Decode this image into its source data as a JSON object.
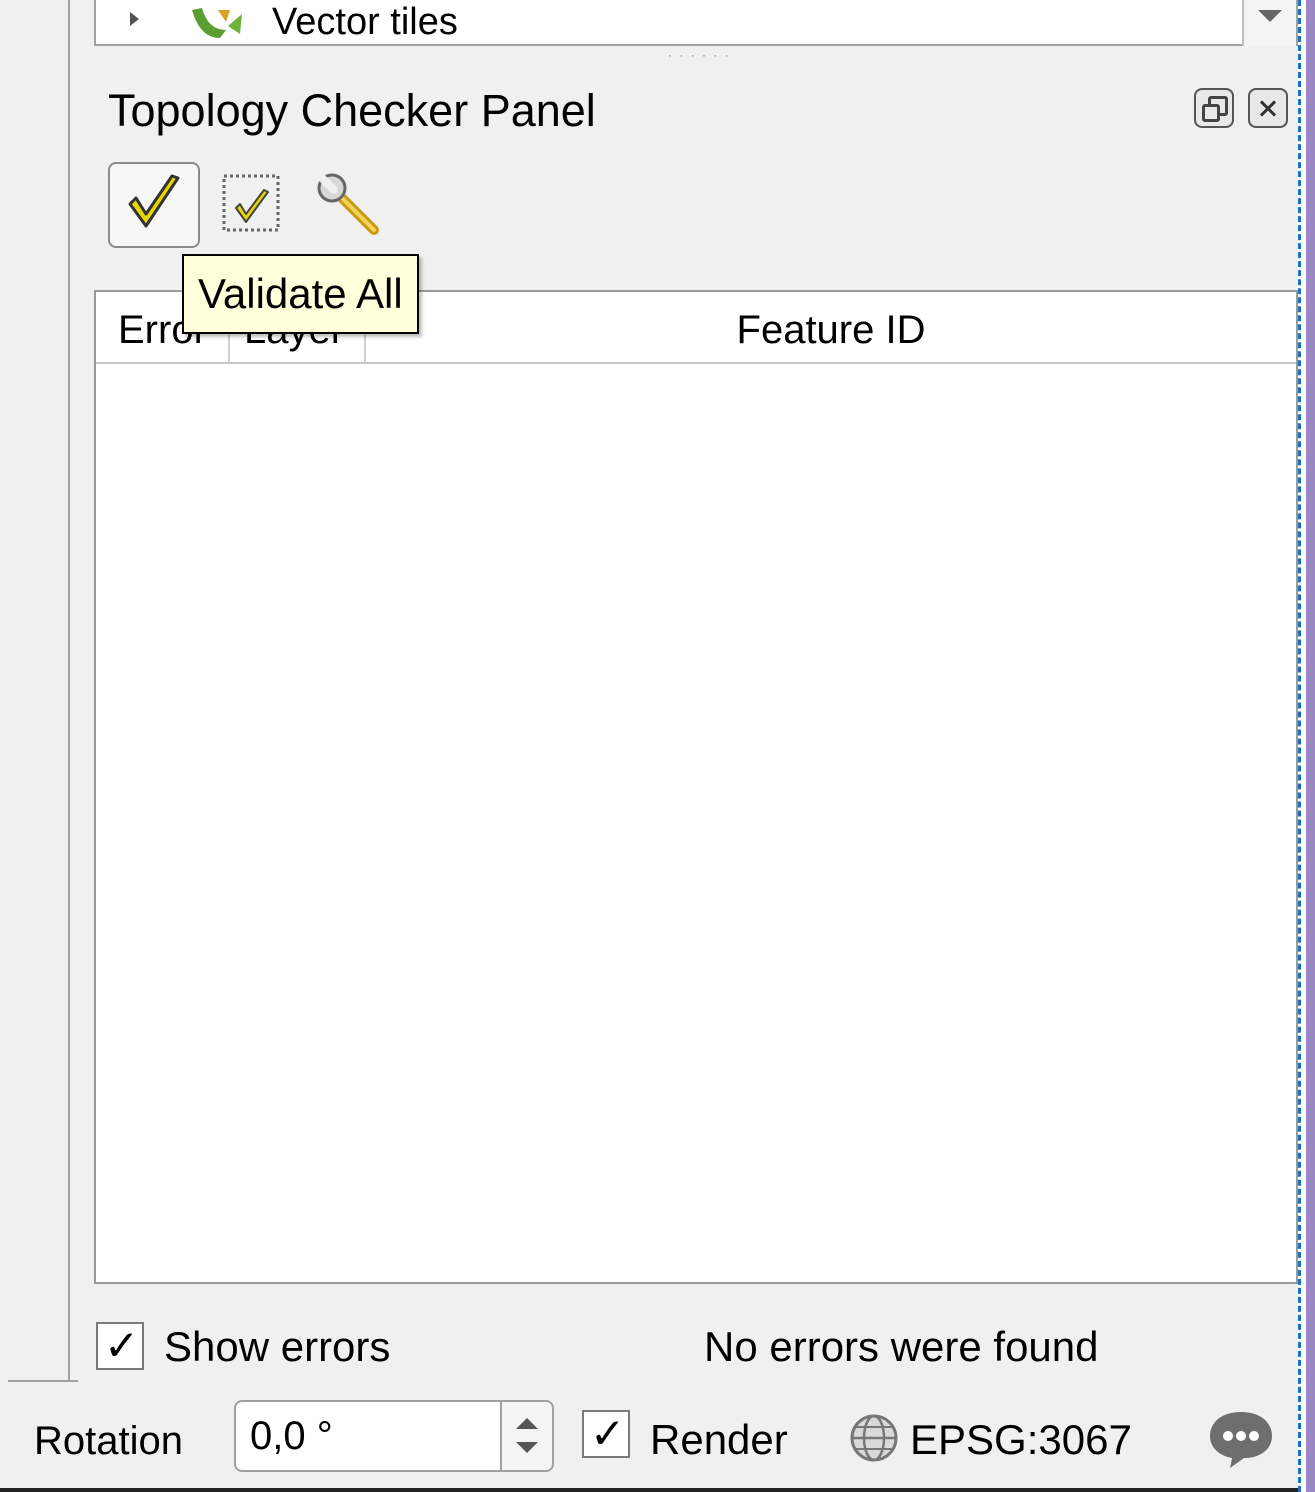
{
  "layer_tree": {
    "partial_item_label": "Vector tiles"
  },
  "panel": {
    "title": "Topology Checker Panel",
    "tooltip": "Validate All"
  },
  "table": {
    "columns": [
      "Error",
      "Layer",
      "Feature ID"
    ]
  },
  "footer": {
    "show_errors_label": "Show errors",
    "show_errors_checked": true,
    "checkbox_mark": "✓",
    "status_text": "No errors were found"
  },
  "statusbar": {
    "rotation_label": "Rotation",
    "rotation_value": "0,0 °",
    "render_label": "Render",
    "render_checked": true,
    "crs_label": "EPSG:3067"
  },
  "icons": {
    "validate_all": "checkmark-icon",
    "validate_extent": "checkmark-extent-icon",
    "configure": "wrench-icon",
    "crs": "globe-icon",
    "messages": "speech-bubble-icon"
  },
  "colors": {
    "panel_bg": "#f0f0f0",
    "tooltip_bg": "#ffffdc",
    "checkmark_yellow": "#e6d600",
    "map_edge_purple": "#9b87c4",
    "map_edge_blue": "#1e6fbf"
  }
}
